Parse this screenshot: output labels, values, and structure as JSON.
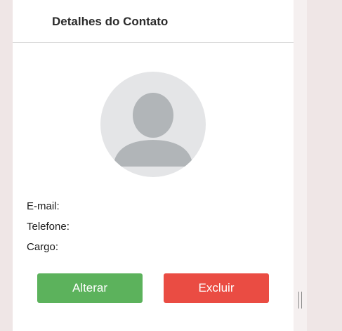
{
  "panel": {
    "title": "Detalhes do Contato"
  },
  "avatar": {
    "icon": "user-placeholder-icon"
  },
  "fields": {
    "email_label": "E-mail:",
    "phone_label": "Telefone:",
    "role_label": "Cargo:"
  },
  "actions": {
    "edit_label": "Alterar",
    "delete_label": "Excluir"
  },
  "colors": {
    "edit_button": "#5cb25c",
    "delete_button": "#ea4c43",
    "avatar_bg": "#e4e5e7",
    "avatar_fg": "#b1b5b8"
  }
}
